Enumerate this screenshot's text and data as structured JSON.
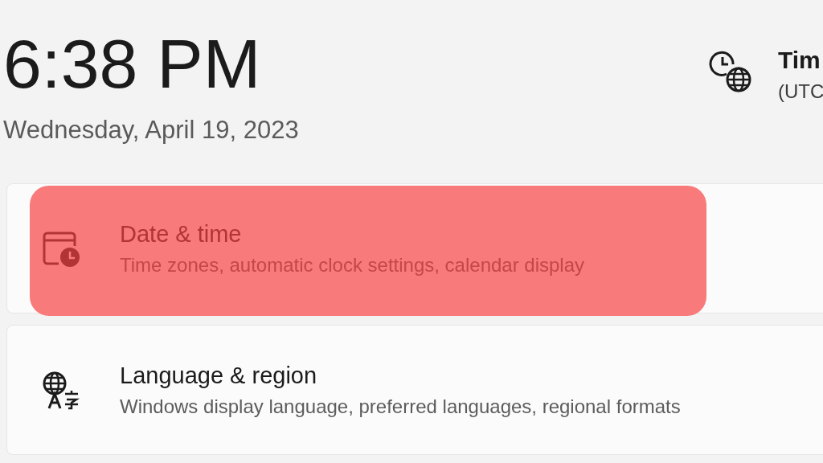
{
  "clock": {
    "time": "6:38 PM",
    "date": "Wednesday, April 19, 2023"
  },
  "timezone": {
    "title": "Tim",
    "subtitle": "(UTC"
  },
  "items": [
    {
      "kind": "date-time",
      "title": "Date & time",
      "description": "Time zones, automatic clock settings, calendar display",
      "highlighted": true
    },
    {
      "kind": "language",
      "title": "Language & region",
      "description": "Windows display language, preferred languages, regional formats",
      "highlighted": false
    }
  ]
}
